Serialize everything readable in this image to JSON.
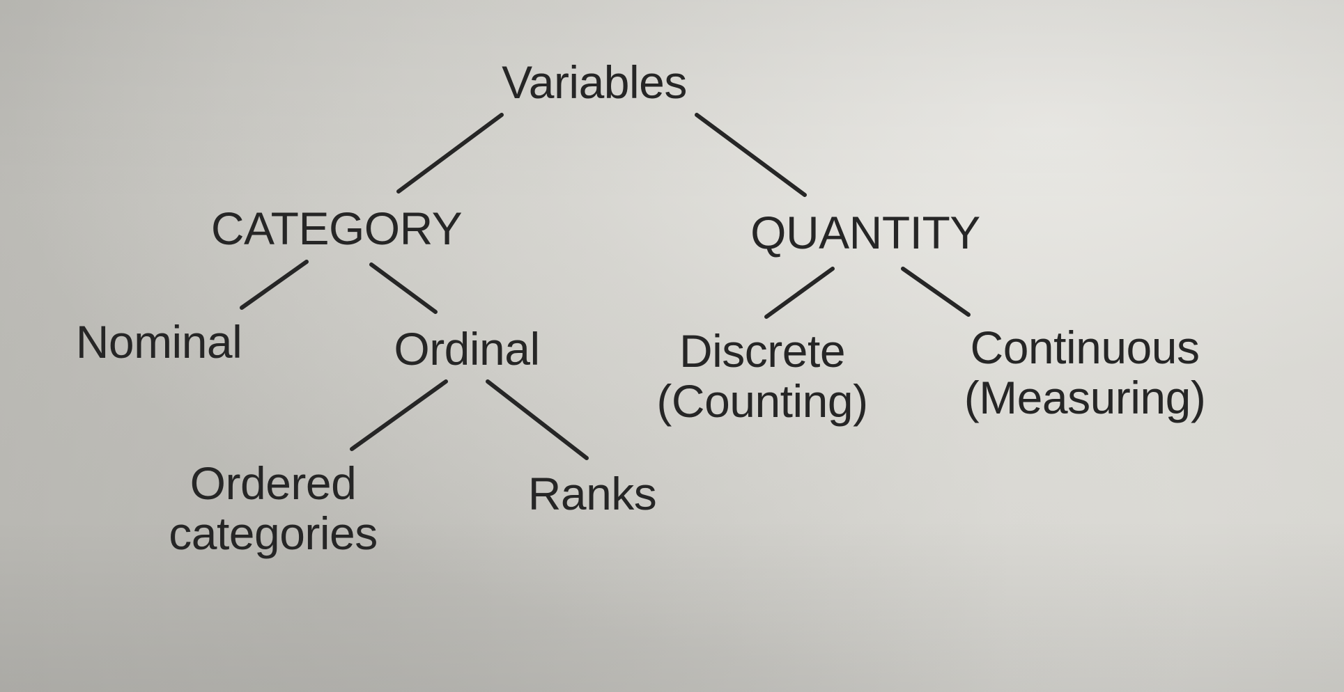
{
  "diagram": {
    "root": {
      "label": "Variables"
    },
    "category": {
      "label": "CATEGORY",
      "nominal": {
        "label": "Nominal"
      },
      "ordinal": {
        "label": "Ordinal",
        "ordered_categories": {
          "line1": "Ordered",
          "line2": "categories"
        },
        "ranks": {
          "label": "Ranks"
        }
      }
    },
    "quantity": {
      "label": "QUANTITY",
      "discrete": {
        "line1": "Discrete",
        "line2": "(Counting)"
      },
      "continuous": {
        "line1": "Continuous",
        "line2": "(Measuring)"
      }
    }
  },
  "colors": {
    "ink": "#262626",
    "paper": "#d4d3ce"
  }
}
